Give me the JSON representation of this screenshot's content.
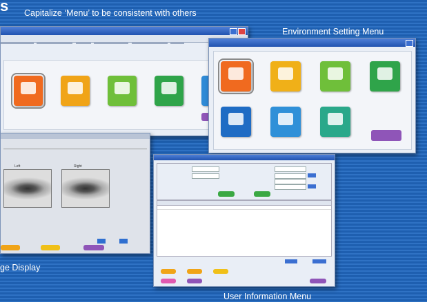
{
  "captions": {
    "top_left_fragment": "s",
    "top_note": "Capitalize ‘Menu’ to be consistent with others",
    "env_menu": "Environment Setting Menu",
    "image_display": "ge Display",
    "user_info_menu": "User Information Menu"
  },
  "main_window": {
    "title": "",
    "menu": [
      "",
      "",
      "",
      "",
      "",
      ""
    ],
    "tiles": [
      {
        "color": "#f06a1f"
      },
      {
        "color": "#f0a418"
      },
      {
        "color": "#6fbf3a"
      },
      {
        "color": "#2fa44a"
      },
      {
        "color": "#2f8ad6"
      }
    ]
  },
  "env_window": {
    "title": "",
    "tiles": [
      {
        "color": "#f06a1f"
      },
      {
        "color": "#f0b018"
      },
      {
        "color": "#6fbf3a"
      },
      {
        "color": "#2fa44a"
      },
      {
        "color": "#1f6cc4"
      },
      {
        "color": "#2f90d8"
      },
      {
        "color": "#2aa88a"
      }
    ],
    "back_button_color": "#8f55b8"
  },
  "image_window": {
    "eye_labels": [
      "Left",
      "Right"
    ]
  },
  "user_window": {
    "title": ""
  }
}
